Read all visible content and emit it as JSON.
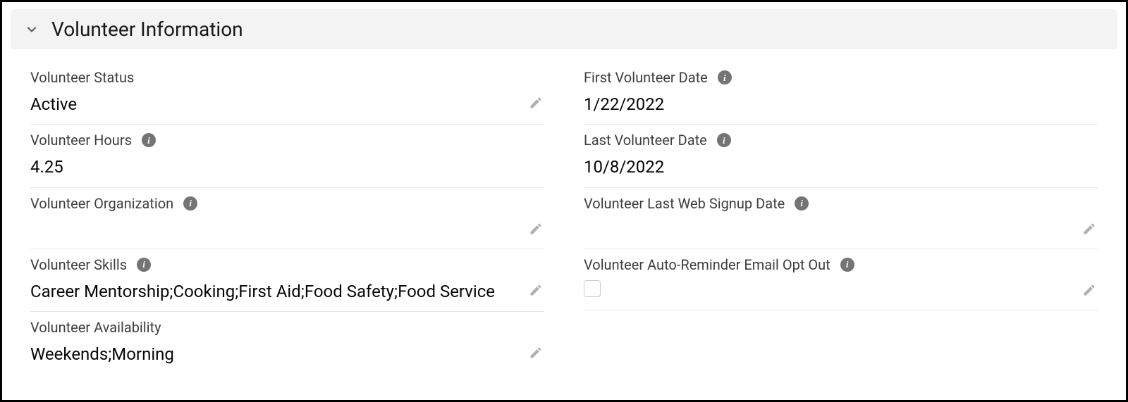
{
  "section": {
    "title": "Volunteer Information"
  },
  "left": {
    "status": {
      "label": "Volunteer Status",
      "value": "Active",
      "info": false,
      "editable": true
    },
    "hours": {
      "label": "Volunteer Hours",
      "value": "4.25",
      "info": true,
      "editable": false
    },
    "organization": {
      "label": "Volunteer Organization",
      "value": "",
      "info": true,
      "editable": true
    },
    "skills": {
      "label": "Volunteer Skills",
      "value": "Career Mentorship;Cooking;First Aid;Food Safety;Food Service",
      "info": true,
      "editable": true
    },
    "availability": {
      "label": "Volunteer Availability",
      "value": "Weekends;Morning",
      "info": false,
      "editable": true
    }
  },
  "right": {
    "first_date": {
      "label": "First Volunteer Date",
      "value": "1/22/2022",
      "info": true,
      "editable": false
    },
    "last_date": {
      "label": "Last Volunteer Date",
      "value": "10/8/2022",
      "info": true,
      "editable": false
    },
    "web_signup": {
      "label": "Volunteer Last Web Signup Date",
      "value": "",
      "info": true,
      "editable": true
    },
    "opt_out": {
      "label": "Volunteer Auto-Reminder Email Opt Out",
      "checked": false,
      "info": true,
      "editable": true
    }
  }
}
